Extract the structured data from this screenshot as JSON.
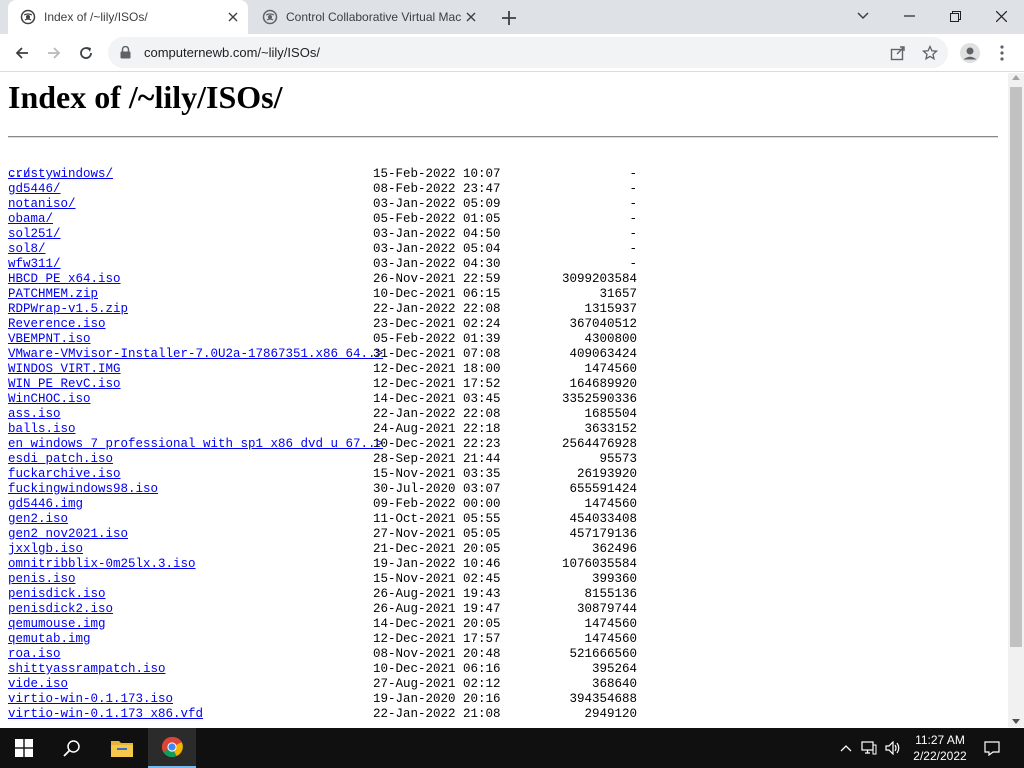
{
  "browser": {
    "tabs": [
      {
        "title": "Index of /~lily/ISOs/",
        "active": true,
        "icon": "globe-icon"
      },
      {
        "title": "Control Collaborative Virtual Mac",
        "active": false,
        "icon": "globe-icon"
      }
    ],
    "url": "computernewb.com/~lily/ISOs/"
  },
  "page": {
    "heading": "Index of /~lily/ISOs/",
    "parent_link": "../",
    "entries": [
      {
        "name": "crustywindows/",
        "date": "15-Feb-2022 10:07",
        "size": "-"
      },
      {
        "name": "gd5446/",
        "date": "08-Feb-2022 23:47",
        "size": "-"
      },
      {
        "name": "notaniso/",
        "date": "03-Jan-2022 05:09",
        "size": "-"
      },
      {
        "name": "obama/",
        "date": "05-Feb-2022 01:05",
        "size": "-"
      },
      {
        "name": "sol251/",
        "date": "03-Jan-2022 04:50",
        "size": "-"
      },
      {
        "name": "sol8/",
        "date": "03-Jan-2022 05:04",
        "size": "-"
      },
      {
        "name": "wfw311/",
        "date": "03-Jan-2022 04:30",
        "size": "-"
      },
      {
        "name": "HBCD_PE_x64.iso",
        "date": "26-Nov-2021 22:59",
        "size": "3099203584"
      },
      {
        "name": "PATCHMEM.zip",
        "date": "10-Dec-2021 06:15",
        "size": "31657"
      },
      {
        "name": "RDPWrap-v1.5.zip",
        "date": "22-Jan-2022 22:08",
        "size": "1315937"
      },
      {
        "name": "Reverence.iso",
        "date": "23-Dec-2021 02:24",
        "size": "367040512"
      },
      {
        "name": "VBEMPNT.iso",
        "date": "05-Feb-2022 01:39",
        "size": "4300800"
      },
      {
        "name": "VMware-VMvisor-Installer-7.0U2a-17867351.x86_64..>",
        "date": "31-Dec-2021 07:08",
        "size": "409063424"
      },
      {
        "name": "WINDOS_VIRT.IMG",
        "date": "12-Dec-2021 18:00",
        "size": "1474560"
      },
      {
        "name": "WIN_PE_RevC.iso",
        "date": "12-Dec-2021 17:52",
        "size": "164689920"
      },
      {
        "name": "WinCHOC.iso",
        "date": "14-Dec-2021 03:45",
        "size": "3352590336"
      },
      {
        "name": "ass.iso",
        "date": "22-Jan-2022 22:08",
        "size": "1685504"
      },
      {
        "name": "balls.iso",
        "date": "24-Aug-2021 22:18",
        "size": "3633152"
      },
      {
        "name": "en_windows_7_professional_with_sp1_x86_dvd_u_67..>",
        "date": "10-Dec-2021 22:23",
        "size": "2564476928"
      },
      {
        "name": "esdi_patch.iso",
        "date": "28-Sep-2021 21:44",
        "size": "95573"
      },
      {
        "name": "fuckarchive.iso",
        "date": "15-Nov-2021 03:35",
        "size": "26193920"
      },
      {
        "name": "fuckingwindows98.iso",
        "date": "30-Jul-2020 03:07",
        "size": "655591424"
      },
      {
        "name": "gd5446.img",
        "date": "09-Feb-2022 00:00",
        "size": "1474560"
      },
      {
        "name": "gen2.iso",
        "date": "11-Oct-2021 05:55",
        "size": "454033408"
      },
      {
        "name": "gen2_nov2021.iso",
        "date": "27-Nov-2021 05:05",
        "size": "457179136"
      },
      {
        "name": "jxxlgb.iso",
        "date": "21-Dec-2021 20:05",
        "size": "362496"
      },
      {
        "name": "omnitribblix-0m25lx.3.iso",
        "date": "19-Jan-2022 10:46",
        "size": "1076035584"
      },
      {
        "name": "penis.iso",
        "date": "15-Nov-2021 02:45",
        "size": "399360"
      },
      {
        "name": "penisdick.iso",
        "date": "26-Aug-2021 19:43",
        "size": "8155136"
      },
      {
        "name": "penisdick2.iso",
        "date": "26-Aug-2021 19:47",
        "size": "30879744"
      },
      {
        "name": "qemumouse.img",
        "date": "14-Dec-2021 20:05",
        "size": "1474560"
      },
      {
        "name": "qemutab.img",
        "date": "12-Dec-2021 17:57",
        "size": "1474560"
      },
      {
        "name": "roa.iso",
        "date": "08-Nov-2021 20:48",
        "size": "521666560"
      },
      {
        "name": "shittyassrampatch.iso",
        "date": "10-Dec-2021 06:16",
        "size": "395264"
      },
      {
        "name": "vide.iso",
        "date": "27-Aug-2021 02:12",
        "size": "368640"
      },
      {
        "name": "virtio-win-0.1.173.iso",
        "date": "19-Jan-2020 20:16",
        "size": "394354688"
      },
      {
        "name": "virtio-win-0.1.173_x86.vfd",
        "date": "22-Jan-2022 21:08",
        "size": "2949120"
      }
    ]
  },
  "taskbar": {
    "time": "11:27 AM",
    "date": "2/22/2022"
  }
}
